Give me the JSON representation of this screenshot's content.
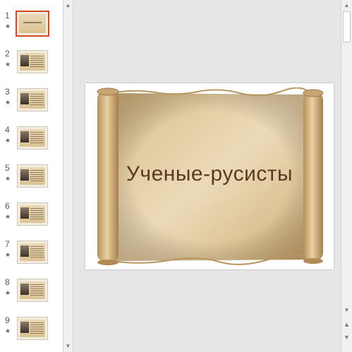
{
  "slides": [
    {
      "number": "1",
      "star": "★",
      "selected": true,
      "kind": "title"
    },
    {
      "number": "2",
      "star": "★",
      "selected": false,
      "kind": "portrait"
    },
    {
      "number": "3",
      "star": "★",
      "selected": false,
      "kind": "portrait"
    },
    {
      "number": "4",
      "star": "★",
      "selected": false,
      "kind": "portrait"
    },
    {
      "number": "5",
      "star": "★",
      "selected": false,
      "kind": "portrait"
    },
    {
      "number": "6",
      "star": "★",
      "selected": false,
      "kind": "portrait"
    },
    {
      "number": "7",
      "star": "★",
      "selected": false,
      "kind": "portrait"
    },
    {
      "number": "8",
      "star": "★",
      "selected": false,
      "kind": "portrait"
    },
    {
      "number": "9",
      "star": "★",
      "selected": false,
      "kind": "portrait"
    }
  ],
  "current_slide": {
    "title": "Ученые-русисты"
  },
  "scrollbar": {
    "up_arrow": "▲",
    "down_arrow": "▼",
    "prev_slide": "⯭",
    "next_slide": "⯯"
  },
  "colors": {
    "selection": "#d24726",
    "title_text": "#5a3a21",
    "paper": "#e0c89a"
  }
}
